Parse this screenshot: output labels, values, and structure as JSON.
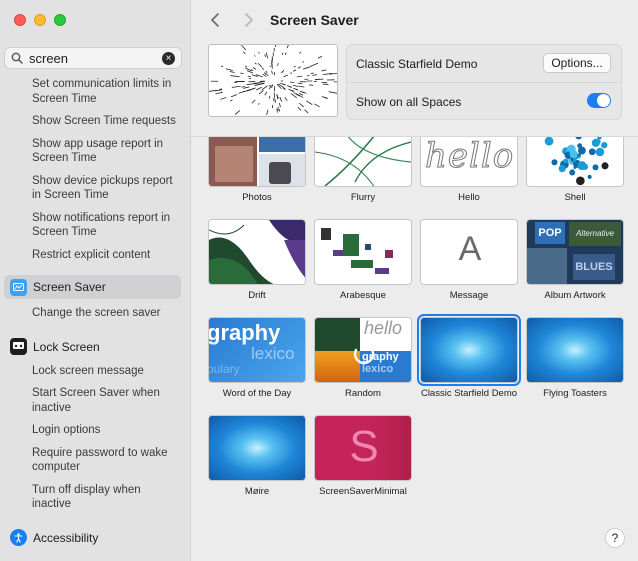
{
  "window": {
    "title": "Screen Saver"
  },
  "search": {
    "value": "screen",
    "clear": "×"
  },
  "sidebar": {
    "screen_time_subs": [
      "Set communication limits in Screen Time",
      "Show Screen Time requests",
      "Show app usage report in Screen Time",
      "Show device pickups report in Screen Time",
      "Show notifications report in Screen Time",
      "Restrict explicit content"
    ],
    "screen_saver": {
      "label": "Screen Saver",
      "subs": [
        "Change the screen saver"
      ]
    },
    "lock_screen": {
      "label": "Lock Screen",
      "subs": [
        "Lock screen message",
        "Start Screen Saver when inactive",
        "Login options",
        "Require password to wake computer",
        "Turn off display when inactive"
      ]
    },
    "accessibility": {
      "label": "Accessibility"
    }
  },
  "header": {
    "saver_name": "Classic Starfield Demo",
    "options_label": "Options...",
    "spaces_label": "Show on all Spaces",
    "spaces_on": true
  },
  "tiles": [
    "Photos",
    "Flurry",
    "Hello",
    "Shell",
    "Drift",
    "Arabesque",
    "Message",
    "Album Artwork",
    "Word of the Day",
    "Random",
    "Classic Starfield Demo",
    "Flying Toasters",
    "Møire",
    "ScreenSaverMinimal"
  ],
  "thumb_text": {
    "hello": "hello",
    "message": "A",
    "word_of_day": "graphy",
    "word_of_day_2": "lexico",
    "word_of_day_3": "bulary",
    "random_1": "hello",
    "random_2": "graphy",
    "random_3": "lexico",
    "minimal": "S",
    "album_1": "POP",
    "album_2": "Alternative",
    "album_3": "BLUES"
  },
  "selected_tile": "Classic Starfield Demo",
  "help": "?",
  "colors": {
    "accent": "#1a7ff0",
    "minimal": "#c5245a"
  }
}
